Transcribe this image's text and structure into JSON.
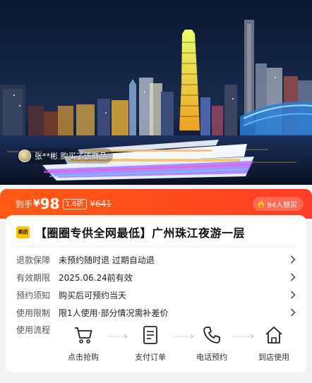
{
  "hero": {
    "buyer_notice": "张**彬 购买了该商品"
  },
  "price_bar": {
    "prefix": "到手",
    "currency": "¥",
    "price": "98",
    "discount": "1.6折",
    "original_price": "¥641",
    "want_count": "94人想买",
    "colors": {
      "start": "#ff5a16",
      "end": "#ff3d26"
    }
  },
  "product": {
    "brand_logo": "美团",
    "title": "【圈圈专供全网最低】广州珠江夜游一层"
  },
  "info_rows": [
    {
      "label": "退款保障",
      "value": "未预约随时退 过期自动退"
    },
    {
      "label": "有效期限",
      "value": "2025.06.24前有效"
    },
    {
      "label": "预约须知",
      "value": "购买后可预约当天"
    },
    {
      "label": "使用限制",
      "value": "限1人使用·部分情况需补差价"
    }
  ],
  "flow": {
    "label": "使用流程",
    "steps": [
      {
        "icon": "cart-icon",
        "label": "点击抢购"
      },
      {
        "icon": "order-icon",
        "label": "支付订单"
      },
      {
        "icon": "phone-icon",
        "label": "电话预约"
      },
      {
        "icon": "store-icon",
        "label": "到店使用"
      }
    ]
  }
}
